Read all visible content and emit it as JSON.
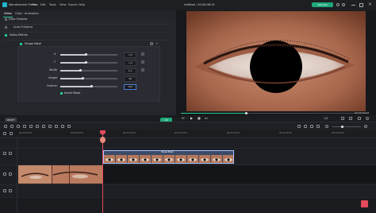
{
  "app": {
    "title": "Wondershare Filmora",
    "menus": [
      "File",
      "Edit",
      "Tools",
      "View",
      "Export",
      "Help"
    ],
    "project_title": "Untitled : 00:00:08:15",
    "tutorials_label": "Tutorials"
  },
  "tabs": [
    "Video",
    "Color",
    "Animation"
  ],
  "left_panel": {
    "rows": [
      "Drop Shadow",
      "Auto Enhance",
      "Video Effects"
    ],
    "effect_name": "Shape Mask",
    "params": [
      {
        "label": "X",
        "value": "-1.0",
        "level": 0.45
      },
      {
        "label": "Y",
        "value": "-1.0",
        "level": 0.45
      },
      {
        "label": "Width",
        "value": "0.1",
        "level": 0.35
      },
      {
        "label": "Height",
        "value": "36",
        "level": 0.4
      },
      {
        "label": "Feather",
        "value": "100",
        "level": 0.55
      }
    ],
    "invert_mask_label": "Invert Mask",
    "reset_label": "RESET",
    "ok_label": "OK"
  },
  "preview": {
    "time": "00:00:00:04",
    "zoom": "1/2",
    "progress": 0.35
  },
  "timeline": {
    "ruler_ticks": [
      "00:00:00:00",
      "00:00:05:00",
      "00:00:10:00",
      "00:00:15:00",
      "00:00:20:00",
      "00:00:25:00",
      "00:00:30:00",
      "00:00:35:00"
    ],
    "clip_label": "Shape Mask",
    "colors": {
      "accent": "#27c98b",
      "playhead": "#e24a5a",
      "clip_border": "#a9c4ff"
    }
  }
}
